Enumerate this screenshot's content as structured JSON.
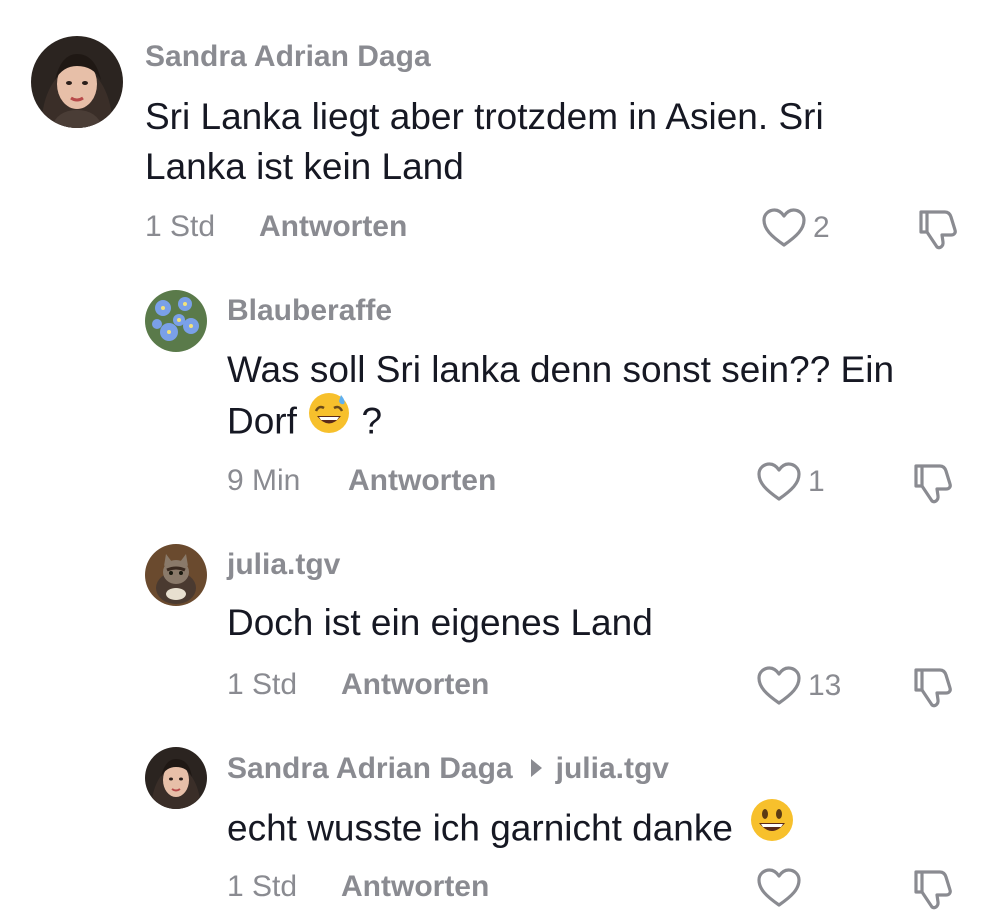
{
  "comments": [
    {
      "username": "Sandra Adrian Daga",
      "text_line1": "Sri Lanka liegt aber trotzdem in Asien. Sri",
      "text_line2": "Lanka ist kein Land",
      "time": "1 Std",
      "reply_label": "Antworten",
      "likes": "2",
      "avatar": "woman-portrait-avatar"
    },
    {
      "username": "Blauberaffe",
      "text_line1": "Was soll Sri lanka denn sonst sein?? Ein",
      "text_line2_pre": "Dorf",
      "text_line2_post": "?",
      "emoji": "grinning-sweat-emoji",
      "time": "9 Min",
      "reply_label": "Antworten",
      "likes": "1",
      "avatar": "blue-flowers-avatar"
    },
    {
      "username": "julia.tgv",
      "text_line1": "Doch ist ein eigenes Land",
      "time": "1 Std",
      "reply_label": "Antworten",
      "likes": "13",
      "avatar": "cat-avatar"
    },
    {
      "username": "Sandra Adrian Daga",
      "reply_to": "julia.tgv",
      "text_line1": "echt wusste ich garnicht danke",
      "emoji": "smiling-emoji",
      "time": "1 Std",
      "reply_label": "Antworten",
      "likes": "",
      "avatar": "woman-portrait-avatar"
    }
  ],
  "colors": {
    "text": "#161823",
    "muted": "#8a8b91",
    "background": "#ffffff"
  }
}
